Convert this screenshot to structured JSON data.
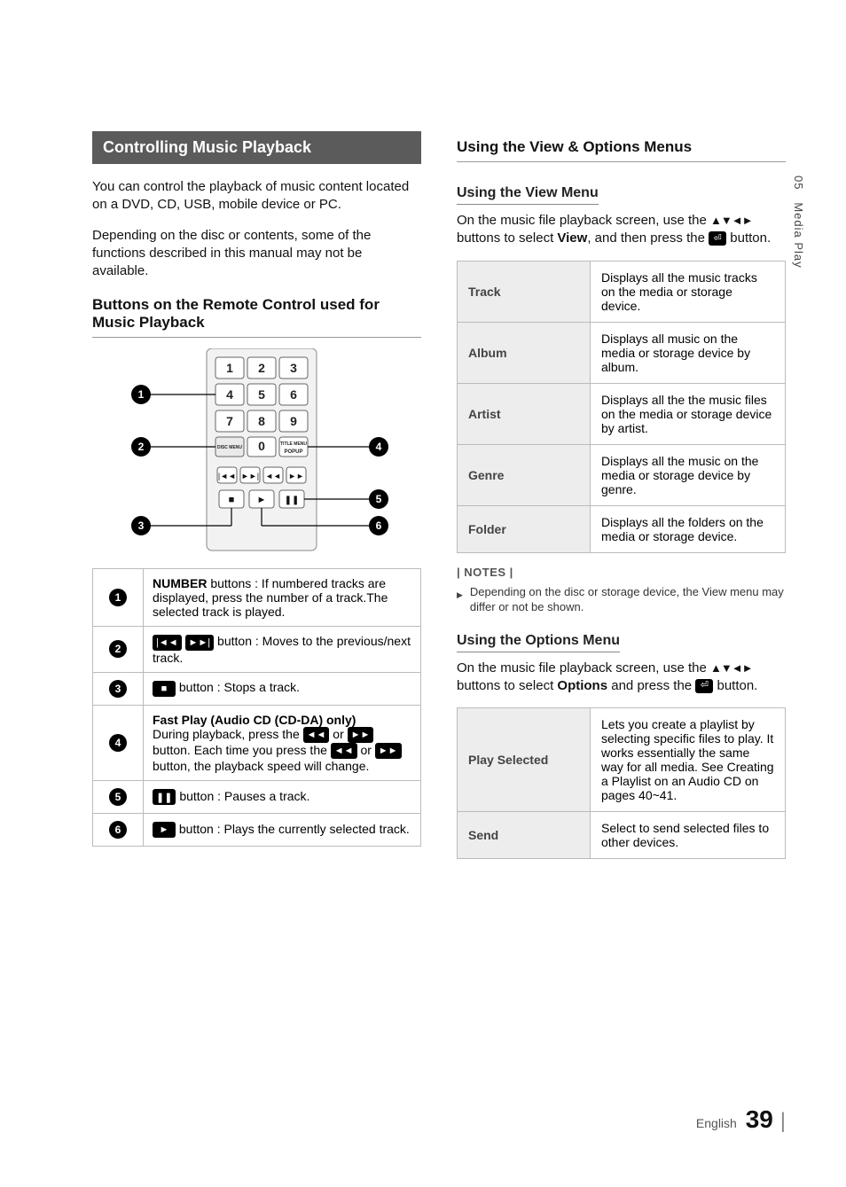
{
  "sideTab": {
    "chapterNum": "05",
    "chapterTitle": "Media Play"
  },
  "footer": {
    "language": "English",
    "pageNumber": "39"
  },
  "left": {
    "sectionTitle": "Controlling Music Playback",
    "intro1": "You can control the playback of music content located on a DVD, CD, USB, mobile device or PC.",
    "intro2": "Depending on the disc or contents, some of the functions described in this manual may not be available.",
    "subHeading": "Buttons on the Remote Control used for Music Playback",
    "remote": {
      "keys": [
        "1",
        "2",
        "3",
        "4",
        "5",
        "6",
        "7",
        "8",
        "9",
        "0"
      ],
      "labels": {
        "discMenu": "DISC MENU",
        "titleMenu": "TITLE MENU",
        "popup": "POPUP"
      },
      "callouts": [
        "1",
        "2",
        "3",
        "4",
        "5",
        "6"
      ]
    },
    "tableRows": [
      {
        "num": "1",
        "html": "<span class='bold'>NUMBER</span> buttons : If numbered tracks are displayed, press the number of a track.The selected track is played."
      },
      {
        "num": "2",
        "html": "<span class='inline-icon' data-name='prev-track-icon' data-interactable='false'>|◄◄</span> <span class='inline-icon' data-name='next-track-icon' data-interactable='false'>►►|</span> button : Moves to the previous/next track."
      },
      {
        "num": "3",
        "html": "<span class='inline-icon' data-name='stop-icon' data-interactable='false'>■</span> button : Stops a track."
      },
      {
        "num": "4",
        "html": "<span class='bold'>Fast Play (Audio CD (CD-DA) only)</span><br>During playback, press the <span class='inline-icon' data-name='rewind-icon' data-interactable='false'>◄◄</span> or <span class='inline-icon' data-name='forward-icon' data-interactable='false'>►►</span> button. Each time you press the <span class='inline-icon' data-name='rewind-icon-2' data-interactable='false'>◄◄</span> or <span class='inline-icon' data-name='forward-icon-2' data-interactable='false'>►►</span> button, the playback speed will change."
      },
      {
        "num": "5",
        "html": "<span class='inline-icon' data-name='pause-icon' data-interactable='false'>❚❚</span> button : Pauses a track."
      },
      {
        "num": "6",
        "html": "<span class='inline-icon' data-name='play-icon' data-interactable='false'>►</span> button : Plays the currently selected track."
      }
    ]
  },
  "right": {
    "heading": "Using the View & Options Menus",
    "viewHeading": "Using the View Menu",
    "viewIntro": {
      "pre": "On the music file playback screen, use the ",
      "arrows": "▲▼◄►",
      "mid": " buttons to select ",
      "viewWord": "View",
      "mid2": ", and then press the ",
      "post": " button."
    },
    "viewTable": [
      {
        "label": "Track",
        "desc": "Displays all the music tracks on the media or storage device."
      },
      {
        "label": "Album",
        "desc": "Displays all music on the media or storage device by album."
      },
      {
        "label": "Artist",
        "desc": "Displays all the the music files on the media or storage device by artist."
      },
      {
        "label": "Genre",
        "desc": "Displays all the music on the media or storage device by genre."
      },
      {
        "label": "Folder",
        "desc": "Displays all the folders on the media or storage device."
      }
    ],
    "notesLabel": "| NOTES |",
    "note1": "Depending on the disc or storage device, the View menu may differ or not be shown.",
    "optionsHeading": "Using the Options Menu",
    "optionsIntro": {
      "pre": "On the music file playback screen, use the ",
      "arrows": "▲▼◄►",
      "mid": " buttons to select ",
      "optWord": "Options",
      "mid2": " and press the ",
      "post": " button."
    },
    "optionsTable": [
      {
        "label": "Play Selected",
        "desc": "Lets you create a playlist by selecting specific files to play. It works essentially the same way for all media. See Creating a Playlist on an Audio CD on pages 40~41."
      },
      {
        "label": "Send",
        "desc": "Select to send selected files to other devices."
      }
    ]
  }
}
